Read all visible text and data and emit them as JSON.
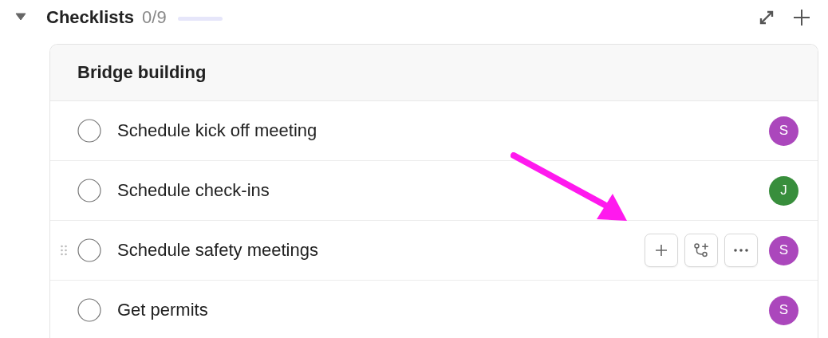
{
  "section": {
    "title": "Checklists",
    "count": "0/9",
    "expanded": true,
    "progress": {
      "level": 0
    }
  },
  "checklist": {
    "title": "Bridge building",
    "items": [
      {
        "label": "Schedule kick off meeting",
        "checked": false,
        "hovered": false,
        "assignee": "S",
        "color": "#ab47bc"
      },
      {
        "label": "Schedule check-ins",
        "checked": false,
        "hovered": false,
        "assignee": "J",
        "color": "#388e3c"
      },
      {
        "label": "Schedule safety meetings",
        "checked": false,
        "hovered": true,
        "assignee": "S",
        "color": "#ab47bc"
      },
      {
        "label": "Get permits",
        "checked": false,
        "hovered": false,
        "assignee": "S",
        "color": "#ab47bc"
      }
    ]
  }
}
